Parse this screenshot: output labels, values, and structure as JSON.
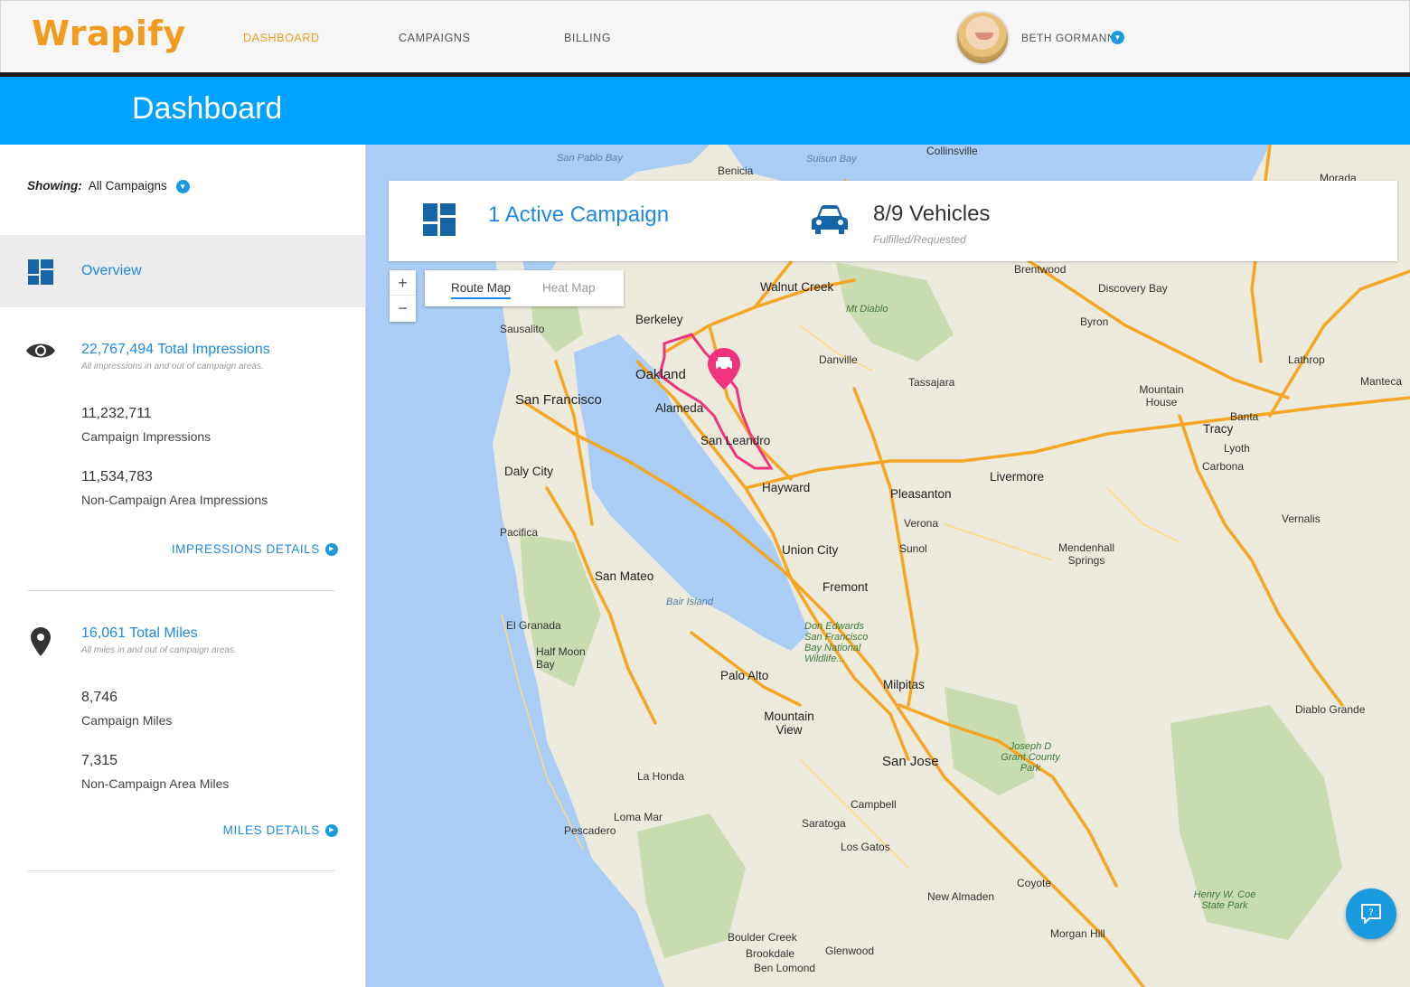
{
  "app": {
    "logo": "Wrapify"
  },
  "nav": {
    "items": [
      {
        "label": "DASHBOARD",
        "active": true
      },
      {
        "label": "CAMPAIGNS",
        "active": false
      },
      {
        "label": "BILLING",
        "active": false
      }
    ],
    "user_name": "BETH GORMANN"
  },
  "header": {
    "title": "Dashboard"
  },
  "sidebar": {
    "showing_label": "Showing:",
    "showing_value": "All Campaigns",
    "overview_label": "Overview",
    "impressions": {
      "title": "22,767,494 Total Impressions",
      "subtitle": "All impressions in and out of campaign areas.",
      "campaign_value": "11,232,711",
      "campaign_label": "Campaign Impressions",
      "noncampaign_value": "11,534,783",
      "noncampaign_label": "Non-Campaign Area Impressions",
      "details_link": "IMPRESSIONS DETAILS"
    },
    "miles": {
      "title": "16,061 Total Miles",
      "subtitle": "All miles in and out of campaign areas.",
      "campaign_value": "8,746",
      "campaign_label": "Campaign Miles",
      "noncampaign_value": "7,315",
      "noncampaign_label": "Non-Campaign Area Miles",
      "details_link": "MILES DETAILS"
    }
  },
  "summary": {
    "campaigns": "1 Active Campaign",
    "vehicles": "8/9 Vehicles",
    "vehicles_sub": "Fulfilled/Requested"
  },
  "map": {
    "tabs": {
      "route": "Route Map",
      "heat": "Heat Map"
    },
    "zoom_in": "+",
    "zoom_out": "−",
    "labels": {
      "san_francisco": "San Francisco",
      "oakland": "Oakland",
      "berkeley": "Berkeley",
      "alameda": "Alameda",
      "san_leandro": "San Leandro",
      "hayward": "Hayward",
      "san_jose": "San Jose",
      "fremont": "Fremont",
      "palo_alto": "Palo Alto",
      "san_mateo": "San Mateo",
      "daly_city": "Daly City",
      "pacifica": "Pacifica",
      "walnut_creek": "Walnut Creek",
      "danville": "Danville",
      "pleasanton": "Pleasanton",
      "livermore": "Livermore",
      "union_city": "Union City",
      "milpitas": "Milpitas",
      "mountain_view": "Mountain View",
      "campbell": "Campbell",
      "saratoga": "Saratoga",
      "los_gatos": "Los Gatos",
      "tracy": "Tracy",
      "manteca": "Manteca",
      "brentwood": "Brentwood",
      "byron": "Byron",
      "discovery_bay": "Discovery Bay",
      "benicia": "Benicia",
      "sausalito": "Sausalito",
      "san_pablo_bay": "San Pablo Bay",
      "suisun_bay": "Suisun Bay",
      "bair_island": "Bair Island",
      "mt_diablo": "Mt Diablo",
      "tassajara": "Tassajara",
      "verona": "Verona",
      "sunol": "Sunol",
      "half_moon_bay": "Half Moon Bay",
      "el_granada": "El Granada",
      "la_honda": "La Honda",
      "loma_mar": "Loma Mar",
      "pescadero": "Pescadero",
      "boulder_creek": "Boulder Creek",
      "brookdale": "Brookdale",
      "ben_lomond": "Ben Lomond",
      "glenwood": "Glenwood",
      "morgan_hill": "Morgan Hill",
      "coyote": "Coyote",
      "new_almaden": "New Almaden",
      "collinsville": "Collinsville",
      "lathrop": "Lathrop",
      "lyoth": "Lyoth",
      "carbona": "Carbona",
      "banta": "Banta",
      "vernalis": "Vernalis",
      "mountain_house": "Mountain House",
      "mendenhall_springs": "Mendenhall Springs",
      "diablo_grande": "Diablo Grande",
      "joseph_grant": "Joseph D Grant County Park",
      "don_edwards": "Don Edwards San Francisco Bay National Wildlife...",
      "henry_coe": "Henry W. Coe State Park",
      "morada": "Morada"
    }
  },
  "colors": {
    "accent_blue": "#00a2ff",
    "link_blue": "#1e88e5",
    "brand_orange": "#f39b1f",
    "route_pink": "#f0337f"
  },
  "icons": {
    "campaign": "dashboard-grid-icon",
    "vehicle": "car-icon",
    "impressions": "eye-icon",
    "miles": "map-pin-icon",
    "chat": "help-chat-icon"
  }
}
